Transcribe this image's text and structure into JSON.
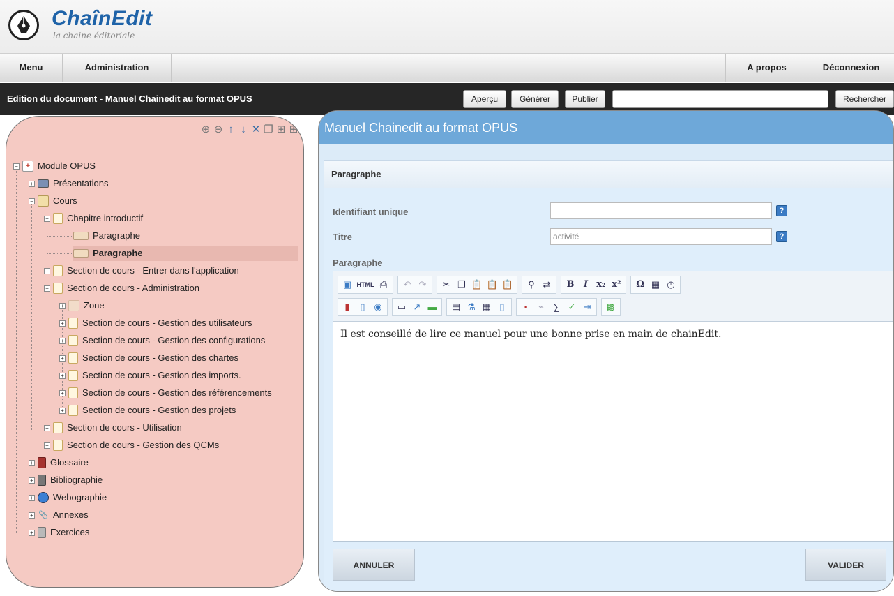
{
  "app": {
    "logo_title": "ChaînEdit",
    "logo_subtitle": "la chaine éditoriale"
  },
  "menu": {
    "menu_label": "Menu",
    "admin_label": "Administration",
    "about_label": "A propos",
    "logout_label": "Déconnexion"
  },
  "titlebar": {
    "doc_title": "Edition du document - Manuel Chainedit au format OPUS",
    "preview_label": "Aperçu",
    "generate_label": "Générer",
    "publish_label": "Publier",
    "search_value": "",
    "search_label": "Rechercher"
  },
  "tree": {
    "root": "Module OPUS",
    "presentations": "Présentations",
    "cours": "Cours",
    "chapitre": "Chapitre introductif",
    "paragraphe1": "Paragraphe",
    "paragraphe2": "Paragraphe",
    "section_entrer": "Section de cours - Entrer dans l'application",
    "section_admin": "Section de cours - Administration",
    "zone": "Zone",
    "gestion_utilisateurs": "Section de cours - Gestion des utilisateurs",
    "gestion_configurations": "Section de cours - Gestion des configurations",
    "gestion_chartes": "Section de cours - Gestion des chartes",
    "gestion_imports": "Section de cours - Gestion des imports.",
    "gestion_referencements": "Section de cours - Gestion des référencements",
    "gestion_projets": "Section de cours - Gestion des projets",
    "section_utilisation": "Section de cours - Utilisation",
    "section_qcm": "Section de cours - Gestion des QCMs",
    "glossaire": "Glossaire",
    "bibliographie": "Bibliographie",
    "webographie": "Webographie",
    "annexes": "Annexes",
    "exercices": "Exercices"
  },
  "panel": {
    "title": "Manuel Chainedit au format OPUS",
    "section_title": "Paragraphe",
    "id_label": "Identifiant unique",
    "id_value": "",
    "titre_label": "Titre",
    "titre_value": "activité",
    "paragraphe_label": "Paragraphe",
    "help_glyph": "?",
    "editor_content": "Il est conseillé de lire ce manuel pour une bonne prise en main de chainEdit.",
    "cancel_label": "ANNULER",
    "validate_label": "VALIDER"
  },
  "colors": {
    "accent_blue": "#1f63a8",
    "tree_panel_bg": "#f5cac3",
    "edit_panel_bg": "#dcebf8",
    "edit_header_bg": "#6ea8d9",
    "titlebar_bg": "#262626"
  }
}
